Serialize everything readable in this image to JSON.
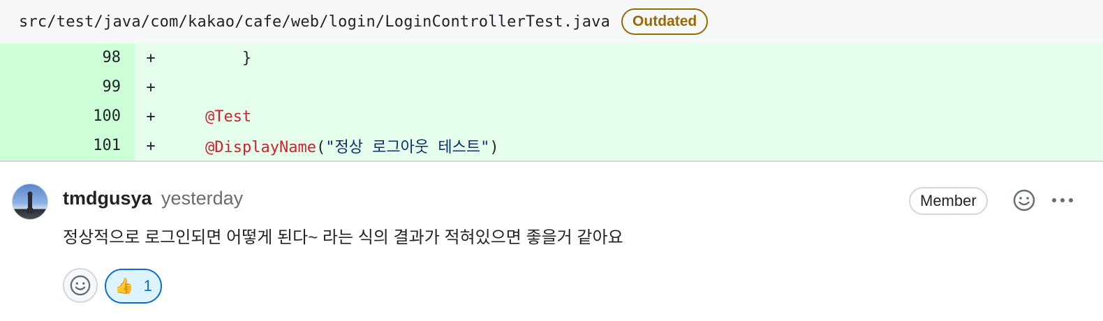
{
  "file": {
    "path": "src/test/java/com/kakao/cafe/web/login/LoginControllerTest.java",
    "badge": "Outdated"
  },
  "diff": {
    "lines": [
      {
        "num": "98",
        "marker": "+",
        "code": "    }"
      },
      {
        "num": "99",
        "marker": "+",
        "code": ""
      },
      {
        "num": "100",
        "marker": "+",
        "annotation": "@Test"
      },
      {
        "num": "101",
        "marker": "+",
        "annotation": "@DisplayName",
        "open": "(",
        "string": "\"정상 로그아웃 테스트\"",
        "close": ")"
      }
    ]
  },
  "comment": {
    "author": "tmdgusya",
    "timestamp": "yesterday",
    "role_badge": "Member",
    "body": "정상적으로 로그인되면 어떻게 된다~ 라는 식의 결과가 적혀있으면 좋을거 같아요",
    "reactions": [
      {
        "emoji": "👍",
        "count": "1"
      }
    ]
  },
  "icons": {
    "add_reaction": "smiley-icon",
    "more": "kebab-horizontal-icon"
  },
  "colors": {
    "diff_bg": "#e6ffec",
    "diff_num_bg": "#ccffd8",
    "annotation": "#cf222e",
    "string": "#0a3069",
    "outdated": "#9a6700",
    "accent": "#0969da"
  }
}
